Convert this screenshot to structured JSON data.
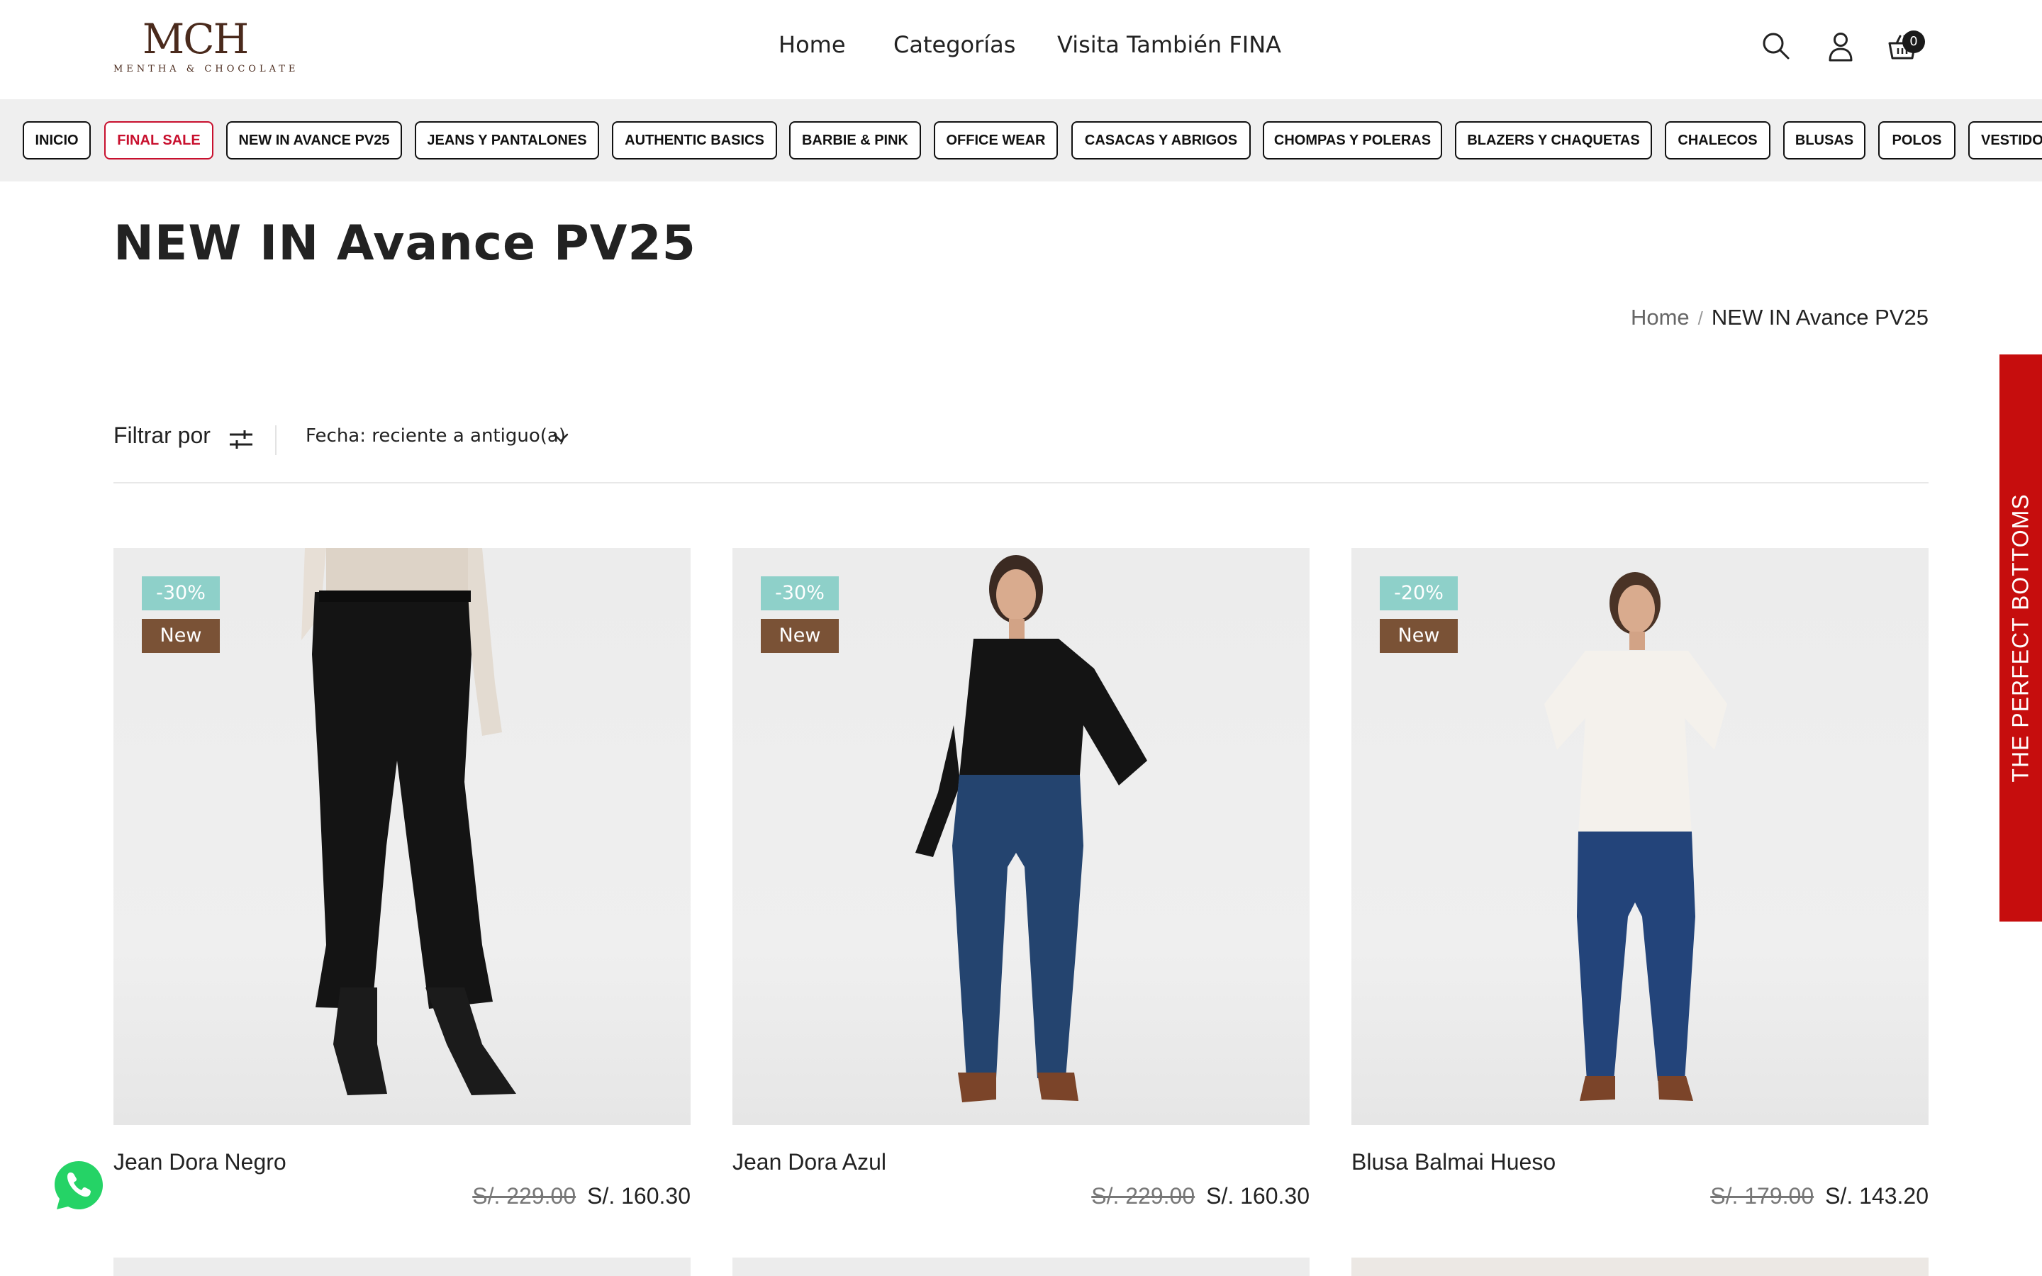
{
  "header": {
    "logo": {
      "mark": "MCH",
      "subtitle": "MENTHA & CHOCOLATE"
    },
    "nav": [
      {
        "label": "Home"
      },
      {
        "label": "Categorías"
      },
      {
        "label": "Visita También FINA"
      }
    ],
    "icons": {
      "search": "search-icon",
      "account": "user-icon",
      "cart": "cart-icon"
    },
    "cart_count": "0"
  },
  "categories": [
    {
      "label": "INICIO"
    },
    {
      "label": "FINAL SALE",
      "highlight": "#c8102e"
    },
    {
      "label": "NEW IN AVANCE PV25"
    },
    {
      "label": "JEANS Y PANTALONES"
    },
    {
      "label": "AUTHENTIC BASICS"
    },
    {
      "label": "BARBIE & PINK"
    },
    {
      "label": "OFFICE WEAR"
    },
    {
      "label": "CASACAS Y ABRIGOS"
    },
    {
      "label": "CHOMPAS Y POLERAS"
    },
    {
      "label": "BLAZERS Y CHAQUETAS"
    },
    {
      "label": "CHALECOS"
    },
    {
      "label": "BLUSAS"
    },
    {
      "label": "POLOS"
    },
    {
      "label": "VESTIDOS"
    }
  ],
  "page": {
    "title": "NEW IN Avance PV25",
    "breadcrumb": {
      "home": "Home",
      "separator": "/",
      "current": "NEW IN Avance PV25"
    }
  },
  "toolbar": {
    "filter_label": "Filtrar por",
    "sort_label": "Fecha: reciente a antiguo(a)"
  },
  "products": [
    {
      "name": "Jean Dora Negro",
      "discount": "-30%",
      "tag": "New",
      "old_price": "S/. 229.00",
      "price": "S/. 160.30"
    },
    {
      "name": "Jean Dora Azul",
      "discount": "-30%",
      "tag": "New",
      "old_price": "S/. 229.00",
      "price": "S/. 160.30"
    },
    {
      "name": "Blusa Balmai Hueso",
      "discount": "-20%",
      "tag": "New",
      "old_price": "S/. 179.00",
      "price": "S/. 143.20"
    }
  ],
  "side_tab": {
    "label": "THE PERFECT BOTTOMS"
  },
  "colors": {
    "brand": "#4a2a1c",
    "sale": "#c8102e",
    "discount_badge": "#8ed0c9",
    "new_badge": "#7a5236",
    "side_tab": "#c60d0d",
    "whatsapp": "#25d366"
  },
  "whatsapp": {
    "icon": "whatsapp-icon"
  }
}
